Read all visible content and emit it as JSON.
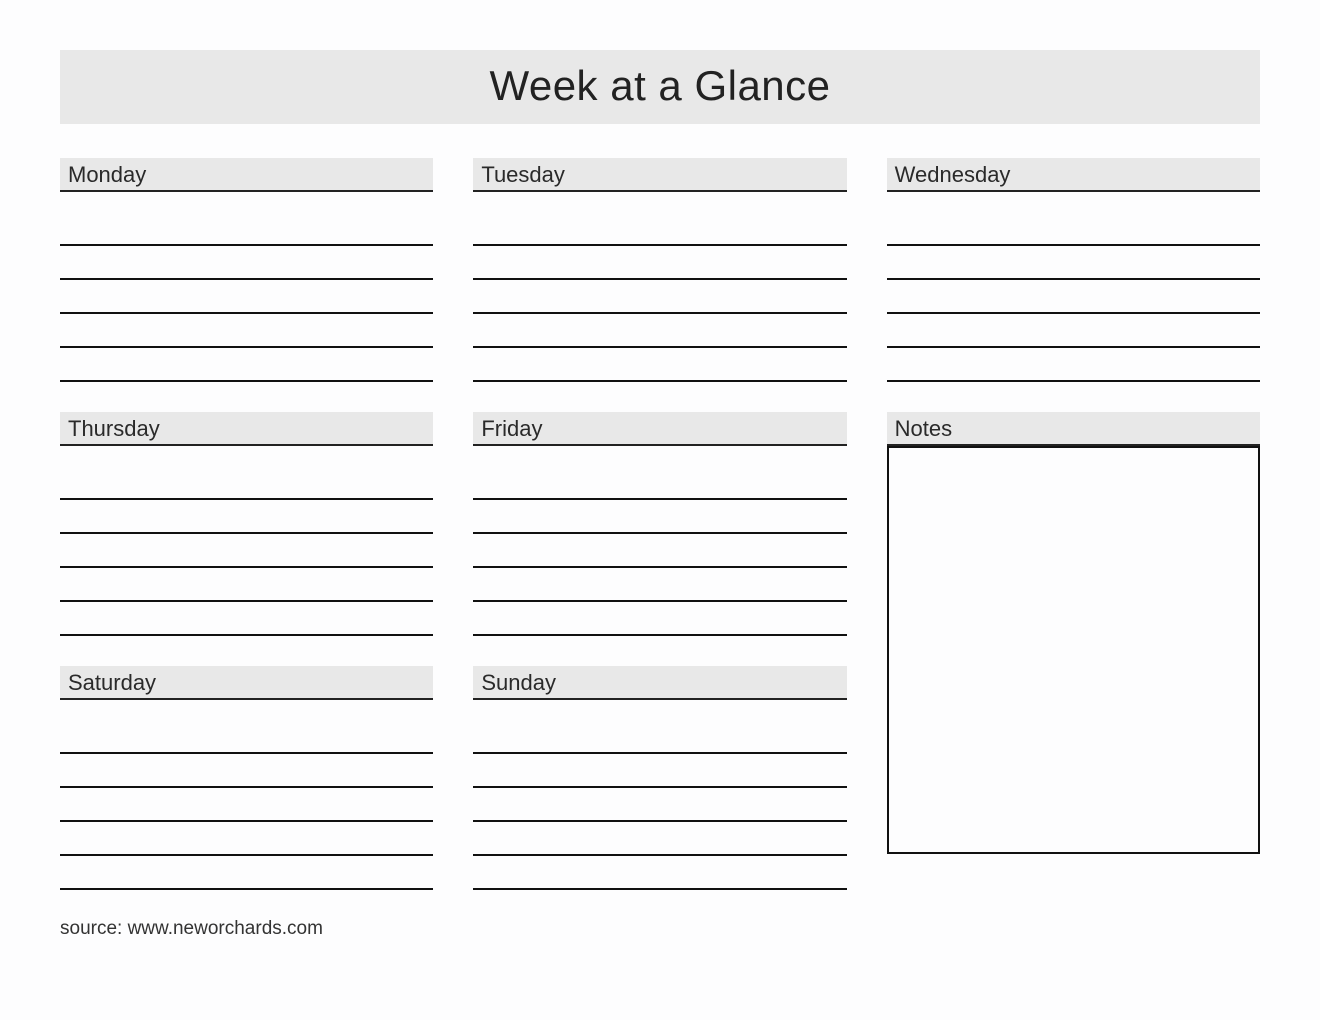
{
  "title": "Week at a Glance",
  "days": {
    "monday": "Monday",
    "tuesday": "Tuesday",
    "wednesday": "Wednesday",
    "thursday": "Thursday",
    "friday": "Friday",
    "saturday": "Saturday",
    "sunday": "Sunday"
  },
  "notes_label": "Notes",
  "source": "source: www.neworchards.com"
}
